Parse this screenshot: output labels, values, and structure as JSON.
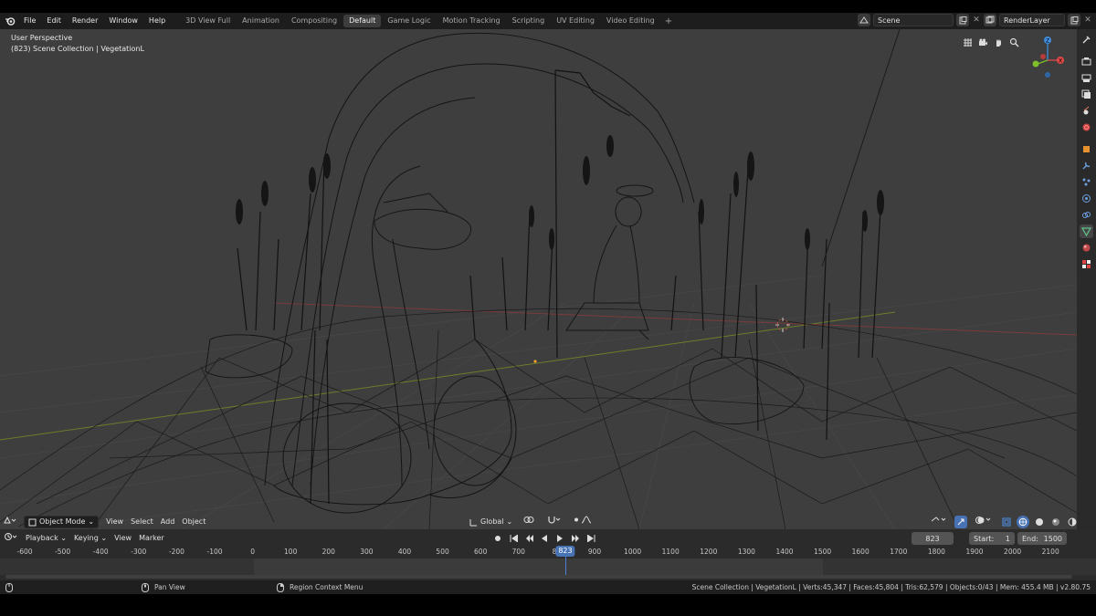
{
  "menu": {
    "items": [
      "File",
      "Edit",
      "Render",
      "Window",
      "Help"
    ]
  },
  "workspaces": {
    "tabs": [
      "3D View Full",
      "Animation",
      "Compositing",
      "Default",
      "Game Logic",
      "Motion Tracking",
      "Scripting",
      "UV Editing",
      "Video Editing"
    ],
    "active": "Default",
    "add_label": "+"
  },
  "scene": {
    "scene_name": "Scene",
    "render_layer": "RenderLayer"
  },
  "viewport": {
    "perspective_label": "User Perspective",
    "collection_label": "(823) Scene Collection | VegetationL",
    "gizmo_axes": [
      "X",
      "Y",
      "Z"
    ]
  },
  "viewport_header": {
    "mode": "Object Mode",
    "view": "View",
    "select": "Select",
    "add": "Add",
    "object": "Object",
    "orientation": "Global"
  },
  "timeline": {
    "playback": "Playback",
    "keying": "Keying",
    "view": "View",
    "marker": "Marker",
    "current_frame": "823",
    "start_label": "Start:",
    "start_value": "1",
    "end_label": "End:",
    "end_value": "1500",
    "ruler_ticks": [
      "-600",
      "-500",
      "-400",
      "-300",
      "-200",
      "-100",
      "0",
      "100",
      "200",
      "300",
      "400",
      "500",
      "600",
      "700",
      "80",
      "900",
      "1000",
      "1100",
      "1200",
      "1300",
      "1400",
      "1500",
      "1600",
      "1700",
      "1800",
      "1900",
      "2000",
      "2100"
    ],
    "playhead_frame": 823
  },
  "statusbar": {
    "pan_view": "Pan View",
    "region_context": "Region Context Menu",
    "stats": "Scene Collection | VegetationL | Verts:45,347 | Faces:45,804 | Tris:62,579 | Objects:0/43 | Mem: 455.4 MB | v2.80.75"
  },
  "colors": {
    "accent": "#4772b3",
    "viewport_bg": "#3e3e3e",
    "header_bg": "#1d1d1d",
    "x_axis": "#e04848",
    "y_axis": "#7fbf2a",
    "z_axis": "#3f8ee0"
  }
}
